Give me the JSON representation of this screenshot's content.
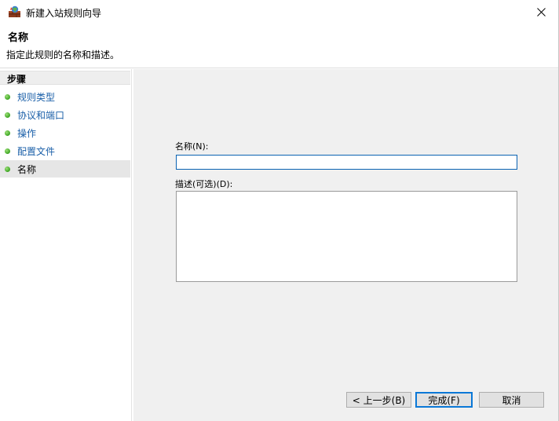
{
  "window": {
    "title": "新建入站规则向导",
    "close_icon": "close-icon"
  },
  "header": {
    "title": "名称",
    "description": "指定此规则的名称和描述。"
  },
  "sidebar": {
    "heading": "步骤",
    "steps": [
      {
        "label": "规则类型",
        "current": false
      },
      {
        "label": "协议和端口",
        "current": false
      },
      {
        "label": "操作",
        "current": false
      },
      {
        "label": "配置文件",
        "current": false
      },
      {
        "label": "名称",
        "current": true
      }
    ]
  },
  "form": {
    "name_label": "名称(N):",
    "name_value": "",
    "description_label": "描述(可选)(D):",
    "description_value": ""
  },
  "buttons": {
    "back": "< 上一步(B)",
    "finish": "完成(F)",
    "cancel": "取消"
  },
  "colors": {
    "accent": "#0a78d7",
    "link": "#1a5fa8",
    "step_dot": "#3aa420",
    "content_bg": "#f0f0f0"
  }
}
